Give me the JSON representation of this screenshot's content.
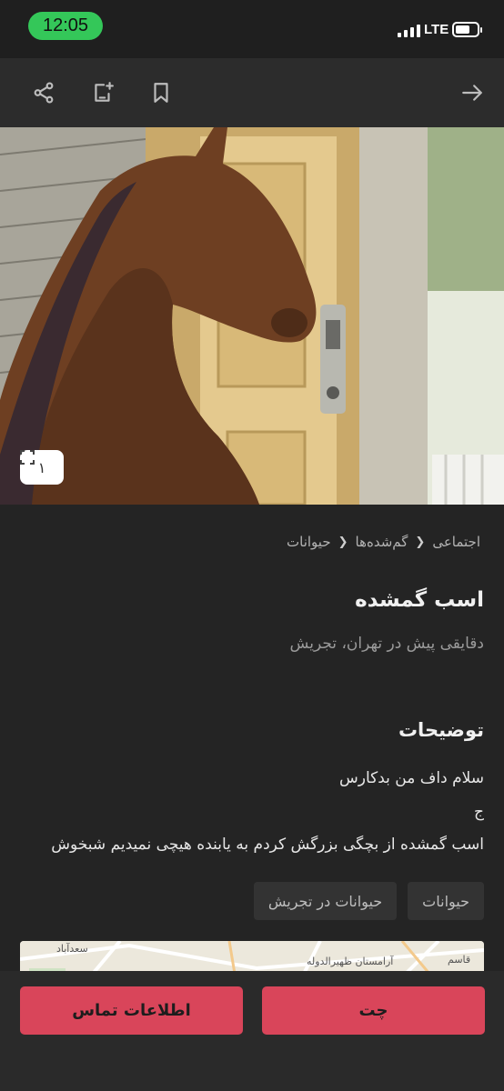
{
  "status_bar": {
    "time": "12:05",
    "network": "LTE",
    "icons": [
      "signal-bars-icon",
      "battery-icon"
    ]
  },
  "toolbar": {
    "icons": [
      "share-icon",
      "add-note-icon",
      "bookmark-icon",
      "back-arrow-icon"
    ]
  },
  "gallery": {
    "image_count": "۱",
    "icons": [
      "fullscreen-icon"
    ]
  },
  "breadcrumb": {
    "items": [
      "اجتماعی",
      "گم‌شده‌ها",
      "حیوانات"
    ],
    "separator_icon": "chevron-left-icon"
  },
  "post": {
    "title": "اسب گمشده",
    "meta": "دقایقی پیش در تهران، تجریش"
  },
  "description": {
    "heading": "توضیحات",
    "lines": [
      "سلام داف من بدکارس",
      "ج",
      "اسب گمشده از بچگی بزرگش کردم به یابنده هیچی نمیدیم شبخوش"
    ]
  },
  "tags": [
    "حیوانات",
    "حیوانات در تجریش"
  ],
  "map": {
    "labels": [
      "آرامستان ظهیرالدوله",
      "سعدآباد",
      "قاسم"
    ]
  },
  "actions": {
    "chat_label": "چت",
    "contact_label": "اطلاعات تماس"
  },
  "colors": {
    "accent": "#d9455a",
    "status_pill": "#34c759",
    "background": "#242424"
  }
}
